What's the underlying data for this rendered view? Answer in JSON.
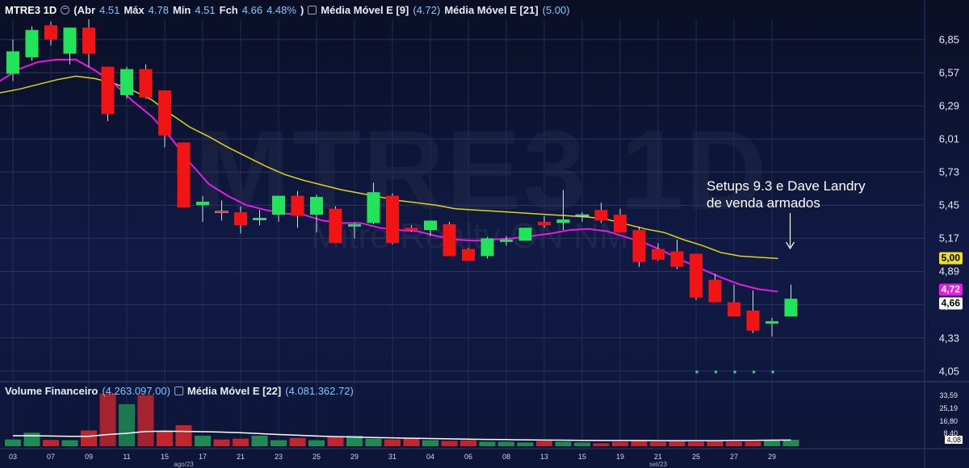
{
  "header": {
    "symbol": "MTRE3 1D",
    "open_label": "(Abr",
    "open": "4.51",
    "high_label": "Máx",
    "high": "4.78",
    "low_label": "Mín",
    "low": "4.51",
    "close_label": "Fch",
    "close": "4.66",
    "change": "4.48%",
    "close_paren": ")",
    "ma9_label": "Média Móvel E [9]",
    "ma9_value": "(4.72)",
    "ma21_label": "Média Móvel E [21]",
    "ma21_value": "(5.00)"
  },
  "volume_header": {
    "label": "Volume Financeiro",
    "value": "(4.263.097.00)",
    "ma_label": "Média Móvel E [22]",
    "ma_value": "(4.081.362.72)"
  },
  "watermark": {
    "title": "MTRE3 1D",
    "subtitle": "Mitre Realty ON NM"
  },
  "annotation": {
    "line1": "Setups 9.3 e Dave Landry",
    "line2": "de venda armados"
  },
  "price_tags": {
    "ma21": "5,00",
    "ma9": "4,72",
    "close": "4,66"
  },
  "colors": {
    "up": "#22e35a",
    "down": "#f01414",
    "ma9": "#e81ae8",
    "ma21": "#e0d416",
    "vol_up": "#1f8a52",
    "vol_down": "#c0262b",
    "vol_ma": "#ffffff"
  },
  "chart_data": {
    "type": "candlestick",
    "title": "MTRE3 1D",
    "y_ticks": [
      "6,85",
      "6,57",
      "6,29",
      "6,01",
      "5,73",
      "5,45",
      "5,17",
      "4,89",
      "4,61",
      "4,33",
      "4,05"
    ],
    "y_values": [
      6.85,
      6.57,
      6.29,
      6.01,
      5.73,
      5.45,
      5.17,
      4.89,
      4.61,
      4.33,
      4.05
    ],
    "ylim": [
      3.98,
      7.02
    ],
    "x_tick_labels": [
      "03",
      "07",
      "09",
      "11",
      "15",
      "17",
      "21",
      "23",
      "25",
      "29",
      "31",
      "04",
      "06",
      "08",
      "13",
      "15",
      "19",
      "21",
      "25",
      "27",
      "29"
    ],
    "x_tick_index": [
      0,
      2,
      4,
      6,
      8,
      10,
      12,
      14,
      16,
      18,
      20,
      22,
      24,
      26,
      28,
      30,
      32,
      34,
      36,
      38,
      40
    ],
    "month_labels": [
      {
        "label": "ago/23",
        "index": 9
      },
      {
        "label": "set/23",
        "index": 34
      }
    ],
    "candles": [
      {
        "o": 6.56,
        "h": 6.85,
        "l": 6.5,
        "c": 6.75
      },
      {
        "o": 6.7,
        "h": 6.96,
        "l": 6.67,
        "c": 6.93
      },
      {
        "o": 6.97,
        "h": 7.0,
        "l": 6.8,
        "c": 6.85
      },
      {
        "o": 6.73,
        "h": 6.95,
        "l": 6.64,
        "c": 6.95
      },
      {
        "o": 6.95,
        "h": 7.02,
        "l": 6.62,
        "c": 6.73
      },
      {
        "o": 6.62,
        "h": 6.62,
        "l": 6.16,
        "c": 6.22
      },
      {
        "o": 6.38,
        "h": 6.62,
        "l": 6.35,
        "c": 6.6
      },
      {
        "o": 6.6,
        "h": 6.64,
        "l": 6.35,
        "c": 6.36
      },
      {
        "o": 6.42,
        "h": 6.42,
        "l": 5.94,
        "c": 6.04
      },
      {
        "o": 5.98,
        "h": 5.98,
        "l": 5.43,
        "c": 5.43
      },
      {
        "o": 5.45,
        "h": 5.53,
        "l": 5.31,
        "c": 5.48
      },
      {
        "o": 5.4,
        "h": 5.49,
        "l": 5.32,
        "c": 5.39
      },
      {
        "o": 5.39,
        "h": 5.44,
        "l": 5.21,
        "c": 5.28
      },
      {
        "o": 5.33,
        "h": 5.41,
        "l": 5.28,
        "c": 5.34
      },
      {
        "o": 5.37,
        "h": 5.49,
        "l": 5.31,
        "c": 5.53
      },
      {
        "o": 5.53,
        "h": 5.57,
        "l": 5.26,
        "c": 5.36
      },
      {
        "o": 5.37,
        "h": 5.54,
        "l": 5.22,
        "c": 5.52
      },
      {
        "o": 5.42,
        "h": 5.44,
        "l": 5.14,
        "c": 5.13
      },
      {
        "o": 5.27,
        "h": 5.3,
        "l": 5.17,
        "c": 5.29
      },
      {
        "o": 5.3,
        "h": 5.64,
        "l": 5.29,
        "c": 5.56
      },
      {
        "o": 5.53,
        "h": 5.55,
        "l": 5.12,
        "c": 5.13
      },
      {
        "o": 5.26,
        "h": 5.28,
        "l": 5.23,
        "c": 5.24
      },
      {
        "o": 5.24,
        "h": 5.32,
        "l": 5.19,
        "c": 5.32
      },
      {
        "o": 5.29,
        "h": 5.31,
        "l": 5.02,
        "c": 5.02
      },
      {
        "o": 5.08,
        "h": 5.09,
        "l": 4.99,
        "c": 4.98
      },
      {
        "o": 5.02,
        "h": 5.18,
        "l": 5.0,
        "c": 5.17
      },
      {
        "o": 5.14,
        "h": 5.19,
        "l": 5.11,
        "c": 5.16
      },
      {
        "o": 5.15,
        "h": 5.26,
        "l": 5.16,
        "c": 5.26
      },
      {
        "o": 5.31,
        "h": 5.36,
        "l": 5.26,
        "c": 5.28
      },
      {
        "o": 5.3,
        "h": 5.58,
        "l": 5.24,
        "c": 5.33
      },
      {
        "o": 5.36,
        "h": 5.39,
        "l": 5.31,
        "c": 5.37
      },
      {
        "o": 5.41,
        "h": 5.47,
        "l": 5.3,
        "c": 5.32
      },
      {
        "o": 5.37,
        "h": 5.42,
        "l": 5.24,
        "c": 5.22
      },
      {
        "o": 5.24,
        "h": 5.27,
        "l": 4.93,
        "c": 4.97
      },
      {
        "o": 5.08,
        "h": 5.13,
        "l": 4.98,
        "c": 4.99
      },
      {
        "o": 5.06,
        "h": 5.16,
        "l": 4.91,
        "c": 4.93
      },
      {
        "o": 5.04,
        "h": 5.04,
        "l": 4.65,
        "c": 4.67
      },
      {
        "o": 4.82,
        "h": 4.87,
        "l": 4.63,
        "c": 4.63
      },
      {
        "o": 4.63,
        "h": 4.78,
        "l": 4.54,
        "c": 4.51
      },
      {
        "o": 4.56,
        "h": 4.73,
        "l": 4.37,
        "c": 4.39
      },
      {
        "o": 4.45,
        "h": 4.5,
        "l": 4.34,
        "c": 4.47
      },
      {
        "o": 4.51,
        "h": 4.78,
        "l": 4.51,
        "c": 4.66
      }
    ],
    "ma9": [
      6.5,
      6.6,
      6.66,
      6.68,
      6.68,
      6.59,
      6.48,
      6.33,
      6.2,
      6.02,
      5.81,
      5.63,
      5.53,
      5.45,
      5.41,
      5.38,
      5.37,
      5.32,
      5.3,
      5.3,
      5.26,
      5.24,
      5.23,
      5.19,
      5.16,
      5.15,
      5.16,
      5.17,
      5.19,
      5.21,
      5.24,
      5.25,
      5.23,
      5.18,
      5.13,
      5.06,
      4.98,
      4.91,
      4.84,
      4.78,
      4.74,
      4.72
    ],
    "ma21": [
      6.4,
      6.43,
      6.47,
      6.51,
      6.54,
      6.52,
      6.48,
      6.42,
      6.34,
      6.22,
      6.11,
      6.03,
      5.94,
      5.86,
      5.78,
      5.71,
      5.66,
      5.62,
      5.58,
      5.55,
      5.52,
      5.49,
      5.47,
      5.45,
      5.42,
      5.41,
      5.4,
      5.39,
      5.38,
      5.37,
      5.36,
      5.35,
      5.33,
      5.29,
      5.25,
      5.22,
      5.16,
      5.11,
      5.05,
      5.02,
      5.01,
      5.0
    ],
    "volume": {
      "y_ticks": [
        "33,59",
        "25,19",
        "16,80",
        "8,40",
        "4,08"
      ],
      "y_values": [
        33.59,
        25.19,
        16.8,
        8.4,
        4.08
      ],
      "ylim": [
        0,
        36
      ],
      "values": [
        4.5,
        9.0,
        4.2,
        4.0,
        10.5,
        35.0,
        28.0,
        34.0,
        10.0,
        14.0,
        7.0,
        4.5,
        5.0,
        7.0,
        4.0,
        5.5,
        4.0,
        6.0,
        7.0,
        5.0,
        4.5,
        5.0,
        4.0,
        3.5,
        4.0,
        3.0,
        3.0,
        2.5,
        3.5,
        3.0,
        2.5,
        2.0,
        3.0,
        4.0,
        3.0,
        3.5,
        3.0,
        3.5,
        3.0,
        3.0,
        4.0,
        4.3
      ],
      "ma": [
        7.0,
        7.0,
        6.8,
        6.6,
        6.6,
        7.8,
        8.6,
        9.8,
        10.0,
        9.9,
        9.7,
        9.4,
        9.0,
        8.4,
        7.8,
        7.3,
        6.8,
        6.4,
        6.1,
        5.8,
        5.6,
        5.3,
        5.1,
        4.9,
        4.7,
        4.5,
        4.4,
        4.2,
        4.1,
        4.0,
        3.9,
        3.8,
        3.8,
        3.8,
        3.7,
        3.7,
        3.7,
        3.7,
        3.8,
        3.9,
        4.0,
        4.08
      ]
    }
  }
}
